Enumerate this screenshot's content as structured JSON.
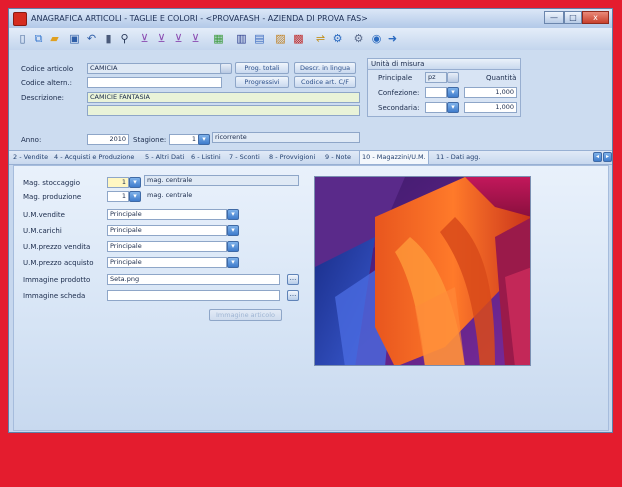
{
  "window": {
    "title": "ANAGRAFICA ARTICOLI - TAGLIE E COLORI - <PROVAFASH - AZIENDA DI PROVA FAS>",
    "minimize": "—",
    "maximize": "□",
    "close": "x"
  },
  "toolbar": {
    "icons": [
      "new-icon",
      "copy-icon",
      "folder-icon",
      "save-icon",
      "undo-icon",
      "delete-icon",
      "find-icon",
      "filter-icon",
      "filter-next-icon",
      "filter-prev-icon",
      "filter-clear-icon",
      "view-icon",
      "barcode-icon",
      "chart-icon",
      "report-icon",
      "print-icon",
      "link-icon",
      "settings-icon",
      "help-icon",
      "exit-icon"
    ]
  },
  "form": {
    "codice_articolo_label": "Codice articolo",
    "codice_articolo_value": "CAMICIA",
    "codice_altern_label": "Codice altern.:",
    "codice_altern_value": "",
    "descrizione_label": "Descrizione:",
    "descrizione_value": "CAMICIE FANTASIA",
    "descrizione2_value": "",
    "anno_label": "Anno:",
    "anno_value": "2010",
    "stagione_label": "Stagione:",
    "stagione_value": "1",
    "stagione_desc": "ricorrente",
    "btn_prog_totali": "Prog. totali",
    "btn_progressivi": "Progressivi",
    "btn_descr_lingua": "Descr. in lingua",
    "btn_codice_art": "Codice art. C/F"
  },
  "unita_misura": {
    "title": "Unità di misura",
    "principale_label": "Principale",
    "principale_value": "pz",
    "quantita_label": "Quantità",
    "confezione_label": "Confezione:",
    "confezione_value": "",
    "confezione_qty": "1,000",
    "secondaria_label": "Secondaria:",
    "secondaria_value": "",
    "secondaria_qty": "1,000"
  },
  "tabs": [
    {
      "label": "2 - Vendite"
    },
    {
      "label": "4 - Acquisti e Produzione"
    },
    {
      "label": "5 - Altri Dati"
    },
    {
      "label": "6 - Listini"
    },
    {
      "label": "7 - Sconti"
    },
    {
      "label": "8 - Provvigioni"
    },
    {
      "label": "9 - Note"
    },
    {
      "label": "10 - Magazzini/U.M."
    },
    {
      "label": "11 - Dati agg."
    }
  ],
  "magazzino": {
    "mag_stoccaggio_label": "Mag. stoccaggio",
    "mag_stoccaggio_value": "1",
    "mag_stoccaggio_desc": "mag. centrale",
    "mag_produzione_label": "Mag. produzione",
    "mag_produzione_value": "1",
    "mag_produzione_desc": "mag. centrale",
    "um_vendite_label": "U.M.vendite",
    "um_vendite_value": "Principale",
    "um_carichi_label": "U.M.carichi",
    "um_carichi_value": "Principale",
    "um_prezzo_vendita_label": "U.M.prezzo vendita",
    "um_prezzo_vendita_value": "Principale",
    "um_prezzo_acquisto_label": "U.M.prezzo acquisto",
    "um_prezzo_acquisto_value": "Principale",
    "immagine_prodotto_label": "Immagine prodotto",
    "immagine_prodotto_value": "Seta.png",
    "immagine_scheda_label": "Immagine scheda",
    "immagine_scheda_value": "",
    "btn_immagine": "Immagine articolo",
    "ellipsis": "..."
  }
}
